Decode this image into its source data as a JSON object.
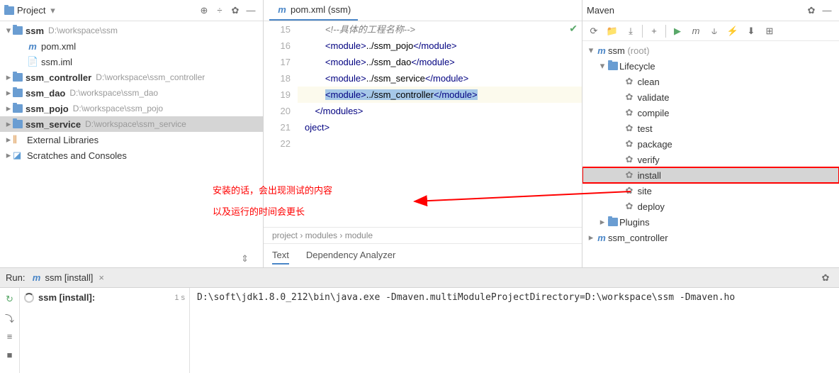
{
  "project": {
    "title": "Project",
    "root": {
      "name": "ssm",
      "path": "D:\\workspace\\ssm"
    },
    "root_children": [
      {
        "icon": "m",
        "name": "pom.xml"
      },
      {
        "icon": "file",
        "name": "ssm.iml"
      }
    ],
    "modules": [
      {
        "name": "ssm_controller",
        "path": "D:\\workspace\\ssm_controller"
      },
      {
        "name": "ssm_dao",
        "path": "D:\\workspace\\ssm_dao"
      },
      {
        "name": "ssm_pojo",
        "path": "D:\\workspace\\ssm_pojo"
      },
      {
        "name": "ssm_service",
        "path": "D:\\workspace\\ssm_service",
        "selected": true
      }
    ],
    "extras": [
      {
        "icon": "lib",
        "name": "External Libraries"
      },
      {
        "icon": "scratch",
        "name": "Scratches and Consoles"
      }
    ]
  },
  "editor": {
    "tab": "pom.xml (ssm)",
    "lines": {
      "l15": "15",
      "l16": "16",
      "l17": "17",
      "l18": "18",
      "l19": "19",
      "l20": "20",
      "l21": "21",
      "l22": "22"
    },
    "code": {
      "comment": "<!--具体的工程名称-->",
      "m1_open": "<module>",
      "m1_text": "../ssm_pojo",
      "m1_close": "</module>",
      "m2_open": "<module>",
      "m2_text": "../ssm_dao",
      "m2_close": "</module>",
      "m3_open": "<module>",
      "m3_text": "../ssm_service",
      "m3_close": "</module>",
      "m4_open": "<module>",
      "m4_text": "../ssm_controller",
      "m4_close": "</module>",
      "modules_close": "</modules>",
      "project_close": "oject>"
    },
    "breadcrumb": "project › modules › module",
    "tabs": {
      "text": "Text",
      "dep": "Dependency Analyzer"
    }
  },
  "annotation": {
    "line1": "安装的话，会出现测试的内容",
    "line2": "以及运行的时间会更长"
  },
  "maven": {
    "title": "Maven",
    "root": "ssm",
    "root_hint": "(root)",
    "lifecycle_label": "Lifecycle",
    "lifecycle": [
      "clean",
      "validate",
      "compile",
      "test",
      "package",
      "verify",
      "install",
      "site",
      "deploy"
    ],
    "plugins": "Plugins",
    "sub": "ssm_controller"
  },
  "run": {
    "label": "Run:",
    "tab": "ssm [install]",
    "task": "ssm [install]:",
    "time": "1 s",
    "output": "D:\\soft\\jdk1.8.0_212\\bin\\java.exe -Dmaven.multiModuleProjectDirectory=D:\\workspace\\ssm -Dmaven.ho"
  }
}
